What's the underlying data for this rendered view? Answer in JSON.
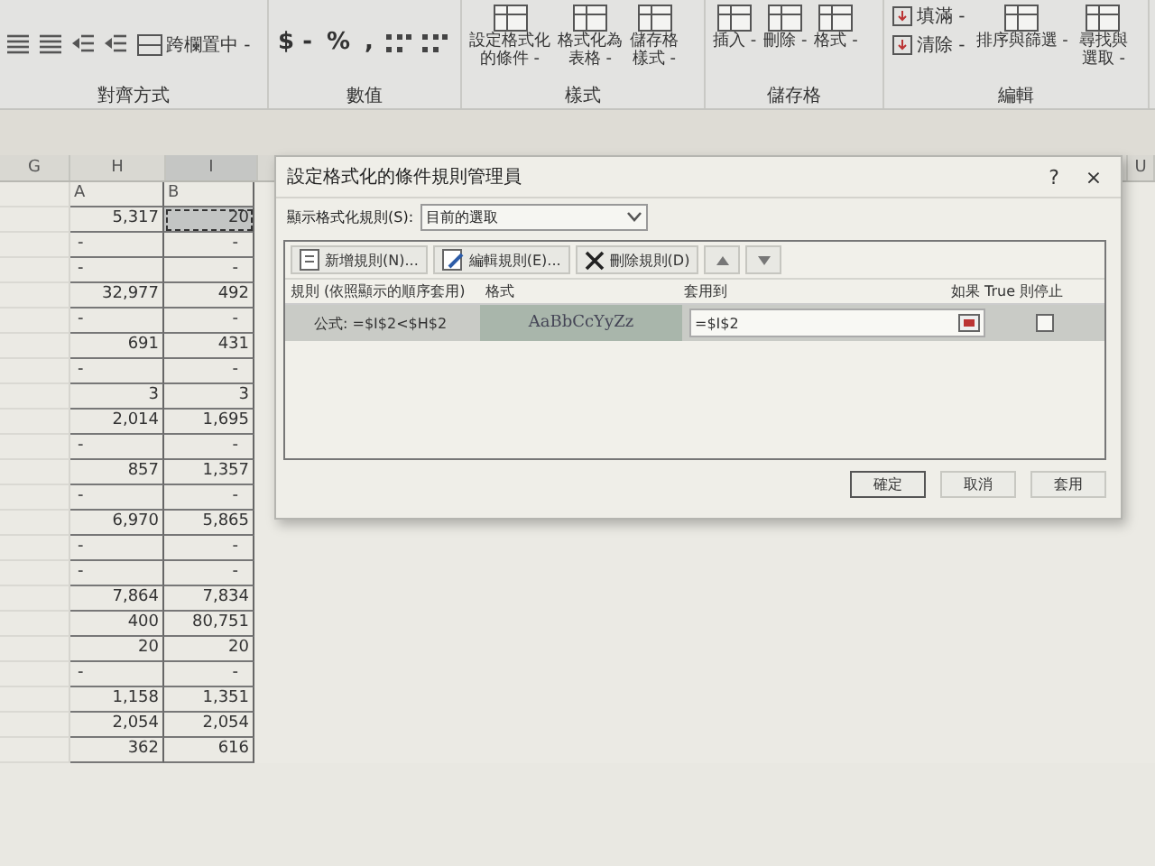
{
  "ribbon": {
    "groups": [
      {
        "label": "對齊方式",
        "items": [
          {
            "kind": "align"
          },
          {
            "kind": "align"
          },
          {
            "kind": "indent"
          },
          {
            "kind": "indent"
          },
          {
            "kind": "merge",
            "label": "跨欄置中",
            "caret": "-"
          }
        ]
      },
      {
        "label": "數值",
        "items": [
          {
            "kind": "glyph",
            "label": "$",
            "caret": "-"
          },
          {
            "kind": "glyph",
            "label": "%"
          },
          {
            "kind": "glyph",
            "label": ","
          },
          {
            "kind": "decimal"
          },
          {
            "kind": "decimal"
          }
        ]
      },
      {
        "label": "樣式",
        "items": [
          {
            "kind": "large",
            "lines": [
              "設定格式化",
              "的條件"
            ],
            "caret": "-"
          },
          {
            "kind": "large",
            "lines": [
              "格式化為",
              "表格"
            ],
            "caret": "-"
          },
          {
            "kind": "large",
            "lines": [
              "儲存格",
              "樣式"
            ],
            "caret": "-"
          }
        ]
      },
      {
        "label": "儲存格",
        "items": [
          {
            "kind": "large",
            "lines": [
              "插入"
            ],
            "caret": "-"
          },
          {
            "kind": "large",
            "lines": [
              "刪除"
            ],
            "caret": "-"
          },
          {
            "kind": "large",
            "lines": [
              "格式"
            ],
            "caret": "-"
          }
        ]
      },
      {
        "label": "編輯",
        "items": [
          {
            "kind": "small",
            "label": "填滿",
            "caret": "-"
          },
          {
            "kind": "small",
            "label": "清除",
            "caret": "-"
          },
          {
            "kind": "large",
            "lines": [
              "排序與篩選"
            ],
            "caret": "-"
          },
          {
            "kind": "large",
            "lines": [
              "尋找與",
              "選取"
            ],
            "caret": "-"
          }
        ]
      }
    ]
  },
  "sheet": {
    "columns": [
      "G",
      "H",
      "I"
    ],
    "far_column": "U",
    "rows": [
      {
        "kind": "label",
        "h": "A",
        "i": "B",
        "selected": false
      },
      {
        "kind": "number",
        "h": "5,317",
        "i": "20",
        "selected": true
      },
      {
        "kind": "dash",
        "h": "-",
        "i": "-",
        "selected": false
      },
      {
        "kind": "dash",
        "h": "-",
        "i": "-",
        "selected": false
      },
      {
        "kind": "number",
        "h": "32,977",
        "i": "492",
        "selected": false
      },
      {
        "kind": "dash",
        "h": "-",
        "i": "-",
        "selected": false
      },
      {
        "kind": "number",
        "h": "691",
        "i": "431",
        "selected": false
      },
      {
        "kind": "dash",
        "h": "-",
        "i": "-",
        "selected": false
      },
      {
        "kind": "number",
        "h": "3",
        "i": "3",
        "selected": false
      },
      {
        "kind": "number",
        "h": "2,014",
        "i": "1,695",
        "selected": false
      },
      {
        "kind": "dash",
        "h": "-",
        "i": "-",
        "selected": false
      },
      {
        "kind": "number",
        "h": "857",
        "i": "1,357",
        "selected": false
      },
      {
        "kind": "dash",
        "h": "-",
        "i": "-",
        "selected": false
      },
      {
        "kind": "number",
        "h": "6,970",
        "i": "5,865",
        "selected": false
      },
      {
        "kind": "dash",
        "h": "-",
        "i": "-",
        "selected": false
      },
      {
        "kind": "dash",
        "h": "-",
        "i": "-",
        "selected": false
      },
      {
        "kind": "number",
        "h": "7,864",
        "i": "7,834",
        "selected": false
      },
      {
        "kind": "number",
        "h": "400",
        "i": "80,751",
        "selected": false
      },
      {
        "kind": "number",
        "h": "20",
        "i": "20",
        "selected": false
      },
      {
        "kind": "dash",
        "h": "-",
        "i": "-",
        "selected": false
      },
      {
        "kind": "number",
        "h": "1,158",
        "i": "1,351",
        "selected": false
      },
      {
        "kind": "number",
        "h": "2,054",
        "i": "2,054",
        "selected": false
      },
      {
        "kind": "number",
        "h": "362",
        "i": "616",
        "selected": false
      }
    ]
  },
  "dialog": {
    "title": "設定格式化的條件規則管理員",
    "help": "?",
    "close": "×",
    "show_label": "顯示格式化規則(S):",
    "show_value": "目前的選取",
    "toolbar": [
      {
        "kind": "new",
        "label": "新增規則(N)..."
      },
      {
        "kind": "edit",
        "label": "編輯規則(E)..."
      },
      {
        "kind": "delete",
        "label": "刪除規則(D)"
      },
      {
        "kind": "up"
      },
      {
        "kind": "down"
      }
    ],
    "columns": [
      "規則 (依照顯示的順序套用)",
      "格式",
      "套用到",
      "如果 True 則停止"
    ],
    "rules": [
      {
        "rule": "公式: =$I$2<$H$2",
        "preview": "AaBbCcYyZz",
        "applies_to": "=$I$2",
        "stop_if_true": false,
        "selected": true
      }
    ],
    "buttons": [
      "確定",
      "取消",
      "套用"
    ]
  }
}
